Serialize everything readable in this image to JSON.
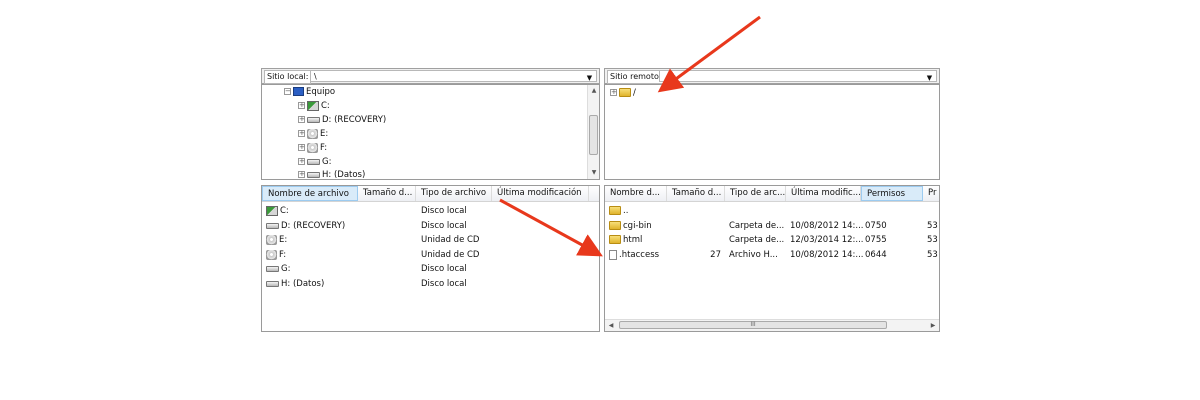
{
  "local": {
    "address_label": "Sitio local:",
    "address_value": "\\",
    "tree": [
      {
        "label": "Equipo",
        "icon": "computer-icon"
      },
      {
        "label": "C:",
        "icon": "system-drive-icon"
      },
      {
        "label": "D: (RECOVERY)",
        "icon": "drive-icon"
      },
      {
        "label": "E:",
        "icon": "cd-drive-icon"
      },
      {
        "label": "F:",
        "icon": "cd-drive-icon"
      },
      {
        "label": "G:",
        "icon": "drive-icon"
      },
      {
        "label": "H: (Datos)",
        "icon": "drive-icon"
      }
    ],
    "columns": [
      "Nombre de archivo",
      "Tamaño d...",
      "Tipo de archivo",
      "Última modificación"
    ],
    "files": [
      {
        "name": "C:",
        "type": "Disco local",
        "icon": "system-drive-icon"
      },
      {
        "name": "D: (RECOVERY)",
        "type": "Disco local",
        "icon": "drive-icon"
      },
      {
        "name": "E:",
        "type": "Unidad de CD",
        "icon": "cd-drive-icon"
      },
      {
        "name": "F:",
        "type": "Unidad de CD",
        "icon": "cd-drive-icon"
      },
      {
        "name": "G:",
        "type": "Disco local",
        "icon": "drive-icon"
      },
      {
        "name": "H: (Datos)",
        "type": "Disco local",
        "icon": "drive-icon"
      }
    ]
  },
  "remote": {
    "address_label": "Sitio remoto:",
    "address_value": "",
    "tree_root": "/",
    "columns": [
      "Nombre d...",
      "Tamaño d...",
      "Tipo de arc...",
      "Última modific...",
      "Permisos",
      "Pr"
    ],
    "files": [
      {
        "name": "..",
        "size": "",
        "type": "",
        "modified": "",
        "perms": "",
        "owner": "",
        "icon": "folder-icon"
      },
      {
        "name": "cgi-bin",
        "size": "",
        "type": "Carpeta de...",
        "modified": "10/08/2012 14:...",
        "perms": "0750",
        "owner": "53",
        "icon": "folder-icon"
      },
      {
        "name": "html",
        "size": "",
        "type": "Carpeta de...",
        "modified": "12/03/2014 12:...",
        "perms": "0755",
        "owner": "53",
        "icon": "folder-icon"
      },
      {
        "name": ".htaccess",
        "size": "27",
        "type": "Archivo H...",
        "modified": "10/08/2012 14:...",
        "perms": "0644",
        "owner": "53",
        "icon": "file-icon"
      }
    ],
    "hscroll_grip": "III"
  },
  "colors": {
    "annotation_arrow": "#e8381c",
    "active_column": "#d9ebf9"
  }
}
